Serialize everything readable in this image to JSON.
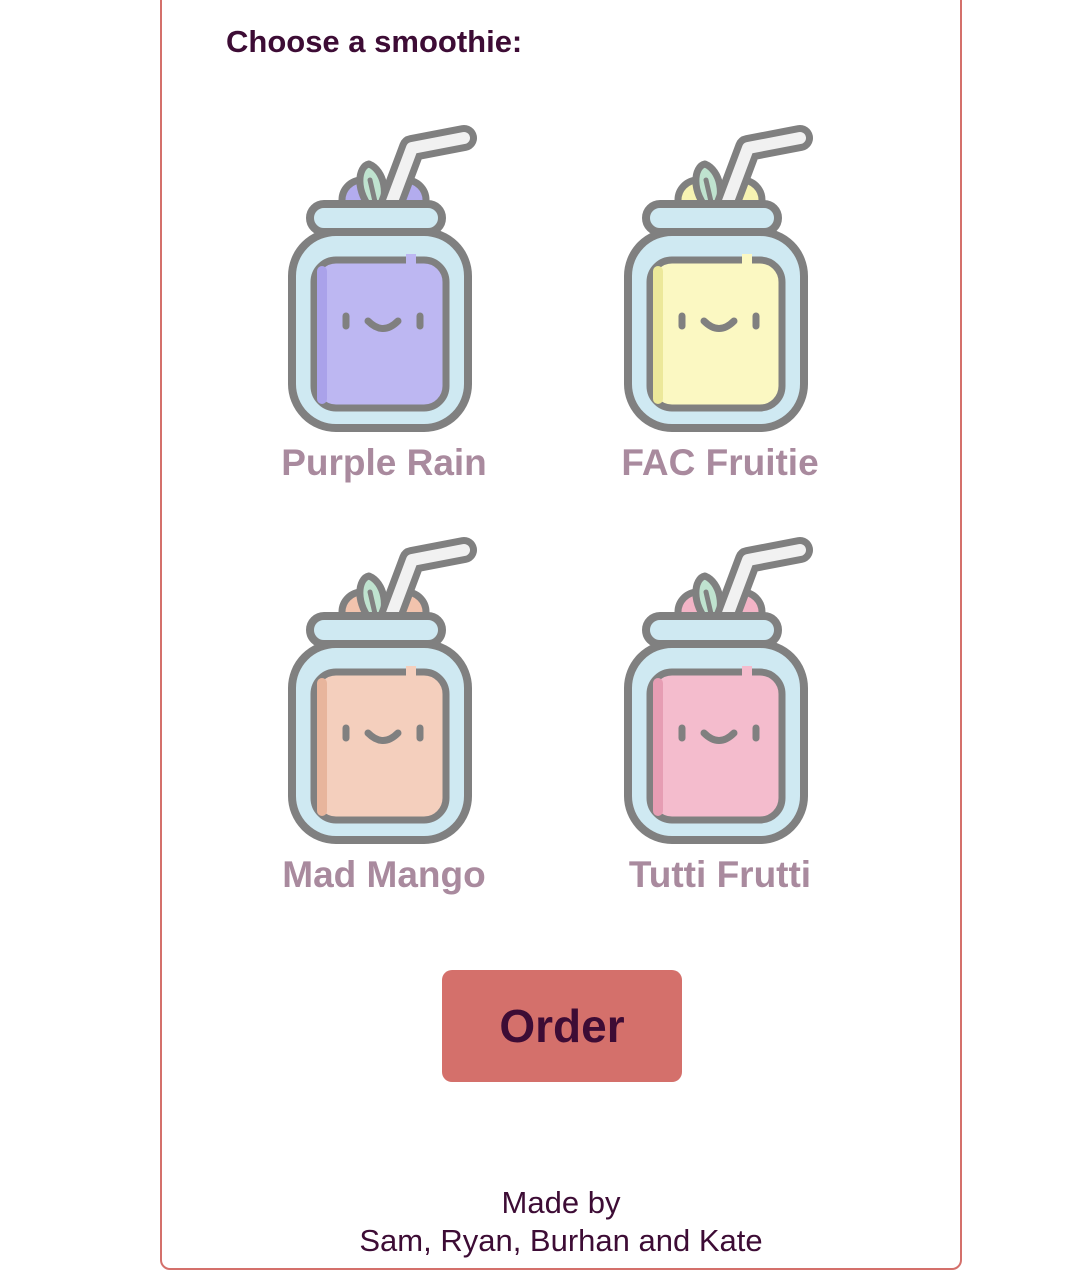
{
  "form": {
    "prompt": "Choose a smoothie:",
    "options": [
      {
        "label": "Purple Rain",
        "icon": "smoothie-jar-icon",
        "color": "#bdb7f2",
        "shade": "#aaa2ea",
        "fruit": "#b3acee"
      },
      {
        "label": "FAC Fruitie",
        "icon": "smoothie-jar-icon",
        "color": "#fbf8c2",
        "shade": "#ece89a",
        "fruit": "#f7f3b2"
      },
      {
        "label": "Mad Mango",
        "icon": "smoothie-jar-icon",
        "color": "#f4cfbd",
        "shade": "#e8b59c",
        "fruit": "#f2c3ad"
      },
      {
        "label": "Tutti Frutti",
        "icon": "smoothie-jar-icon",
        "color": "#f4bccd",
        "shade": "#e69db3",
        "fruit": "#f3b4c6"
      }
    ],
    "order_label": "Order"
  },
  "footer": {
    "line1": "Made by",
    "line2": "Sam, Ryan, Burhan and Kate"
  },
  "colors": {
    "accent": "#d4706b",
    "text_dark": "#3d0c35",
    "label": "#a98a9e",
    "outline": "#808080",
    "glass": "#cfe9f2",
    "leaf": "#bfe3cf"
  }
}
